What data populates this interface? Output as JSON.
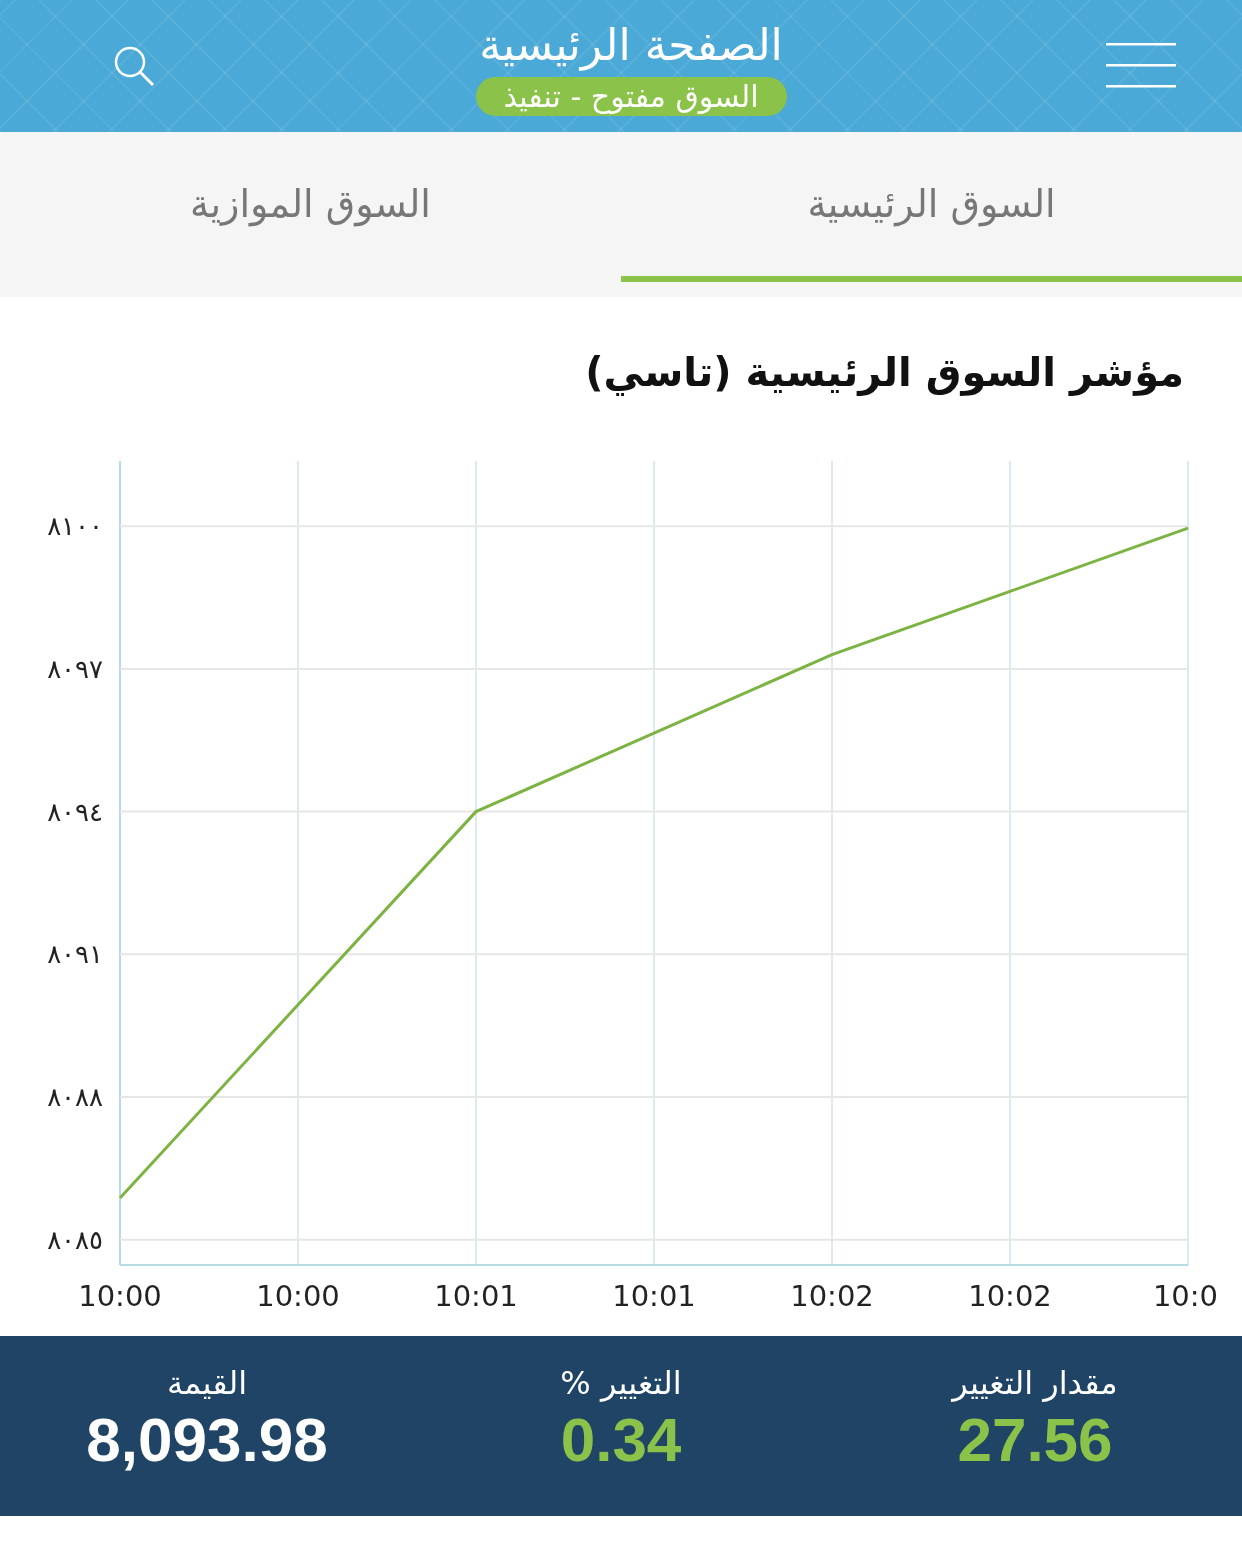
{
  "header": {
    "title": "الصفحة الرئيسية",
    "status": "السوق مفتوح - تنفيذ"
  },
  "tabs": [
    {
      "label": "السوق الرئيسية",
      "selected": true
    },
    {
      "label": "السوق الموازية",
      "selected": false
    }
  ],
  "chart_title": "مؤشر السوق الرئيسية (تاسي)",
  "chart_data": {
    "type": "line",
    "categories": [
      "10:00",
      "10:00",
      "10:01",
      "10:01",
      "10:02",
      "10:02",
      "10:0"
    ],
    "grid": true,
    "series": [
      {
        "color": "#7cb342",
        "values": [
          8085.88,
          8089.94,
          8094.0,
          8095.65,
          8097.3,
          8098.63,
          8099.96
        ]
      }
    ],
    "ylim": [
      8084.47,
      8101.37
    ],
    "yticks": [
      {
        "value": 8100,
        "label": "٨١٠٠"
      },
      {
        "value": 8097,
        "label": "٨٠٩٧"
      },
      {
        "value": 8094,
        "label": "٨٠٩٤"
      },
      {
        "value": 8091,
        "label": "٨٠٩١"
      },
      {
        "value": 8088,
        "label": "٨٠٨٨"
      },
      {
        "value": 8085,
        "label": "٨٠٨٥"
      }
    ]
  },
  "stats": [
    {
      "label": "مقدار التغيير",
      "value": "27.56",
      "color": "#8bc34a"
    },
    {
      "label": "التغيير %",
      "value": "0.34",
      "color": "#8bc34a"
    },
    {
      "label": "القيمة",
      "value": "8,093.98",
      "color": "#ffffff"
    }
  ]
}
